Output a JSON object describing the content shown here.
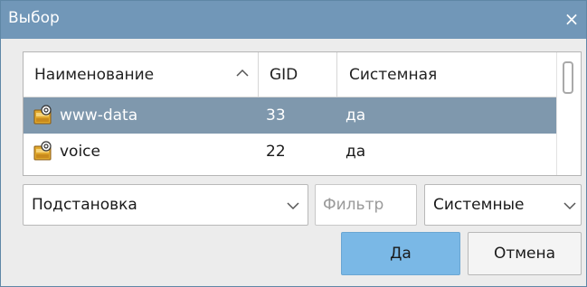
{
  "window": {
    "title": "Выбор",
    "close_glyph": "×",
    "title_bar_color": "#7197b8"
  },
  "table": {
    "columns": [
      {
        "label": "Наименование",
        "sorted": "ascending"
      },
      {
        "label": "GID"
      },
      {
        "label": "Системная"
      }
    ],
    "rows": [
      {
        "icon": "group-icon",
        "name": "www-data",
        "gid": "33",
        "system": "да",
        "selected": true
      },
      {
        "icon": "group-icon",
        "name": "voice",
        "gid": "22",
        "system": "да",
        "selected": false
      }
    ],
    "selection_color": "#7f98ad"
  },
  "filters": {
    "substitution": {
      "value": "Подстановка"
    },
    "filter_input": {
      "placeholder": "Фильтр",
      "value": ""
    },
    "system": {
      "value": "Системные"
    }
  },
  "buttons": {
    "ok": "Да",
    "cancel": "Отмена",
    "ok_color": "#7ab8e6"
  }
}
